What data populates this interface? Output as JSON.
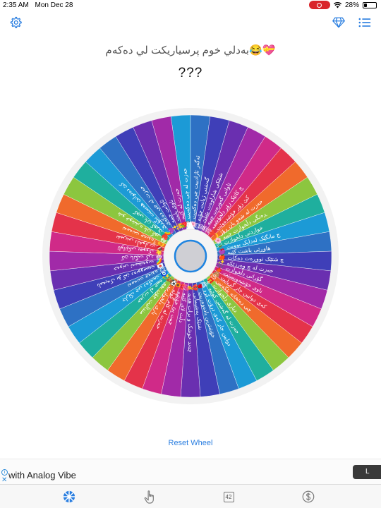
{
  "status_bar": {
    "time": "2:35 AM",
    "date": "Mon Dec 28",
    "battery": "28%",
    "battery_level": 0.28
  },
  "header": {
    "subtitle": "💝😂بەدلي خوم پرسياريكت لي دەكەم",
    "title": "???"
  },
  "wheel": {
    "slice_colors": [
      "#1c9ad6",
      "#2e71c4",
      "#3f3fb8",
      "#6a2fb0",
      "#a12aa8",
      "#d02a88",
      "#e4334a",
      "#f06a2c",
      "#8cc63f",
      "#1faf9e"
    ],
    "ring_color": "#f2f2f2",
    "hub_color": "#1f84e0",
    "segments": [
      "💬 حەزت لە چی دەکەیت",
      "🌸 ئەگەر ئازادبیت چی دەکەیت",
      "😊 گەشتی ژیانت چۆنە",
      "😆 شتێکی شاراوەت پێبڵێ",
      "😎 ئاواتی گەورەت چییە",
      "😄 چ کاتێک زۆر دڵخۆشی",
      "❤️ کێ زۆر خۆشدەوێت",
      "🌙 حەزت لە شەو یان ڕۆژ",
      "🌸 ڕەنگی دڵخوازت چییە",
      "😉 خواردنی دڵخوازت",
      "🍒 چ مانگێک لەدایک بوویت",
      "💜 هاوڕێی باشت کێیە",
      "🍎 چ شتێک تووڕەت دەکات",
      "✨ حەزت لە چ وەرزێکە",
      "🎶 گۆرانی دڵخوازت",
      "🍁 ناوی خۆشەویستت",
      "🙈 کەی دوایین جار گریایت",
      "😍 چی دەتخاتە پێکەنین",
      "🎁 دیاری دڵخوازت",
      "🏝 حەزت لە گەشتی کوێیە",
      "😂 دوایین جار کەی درۆت کرد",
      "🌹 خۆشترین یادەوەریت",
      "💔 شتێک پەشیمانی",
      "✌️ چەند خوشک و برات هەیە",
      "💞 دڵت لای کێیە",
      "🎀 چیت پێ خۆشە",
      "🌻 حەزت لە کام گوڵە",
      "⚽ یاری دڵخوازت",
      "🧸 منداڵیت چۆن بوو",
      "💫 حەزت لە چییە",
      "🧿 جارێک چی دەکەیت",
      "😇 تەمەنت چەندە",
      "💌 نامەیەک بۆ کێ دەنووسیت",
      "🌈 خەونی ئەمشەوت",
      "😂 کێ بانگت کرد",
      "🌟 ئاواتێکی بچووک",
      "🍫 شیرینی دڵخوازت",
      "🫶 تەمەنت چەندە؟",
      "😂 شو خوشترە یان کور",
      "❤️ کچی یان کورێ",
      "🌈 کێ دەتوانێ هەستت بگۆڕێ",
      "💜 حەزت لە چی دەکەی",
      "✨ ئاواتت چییە",
      "👑 ناوی بابت",
      "🍓 حەزت لە کێیە"
    ]
  },
  "actions": {
    "reset_label": "Reset Wheel"
  },
  "ad": {
    "info": "i",
    "close": "✕",
    "text": "with Analog Vibe",
    "cta": "L"
  },
  "tabs": {
    "count_label": "42"
  }
}
